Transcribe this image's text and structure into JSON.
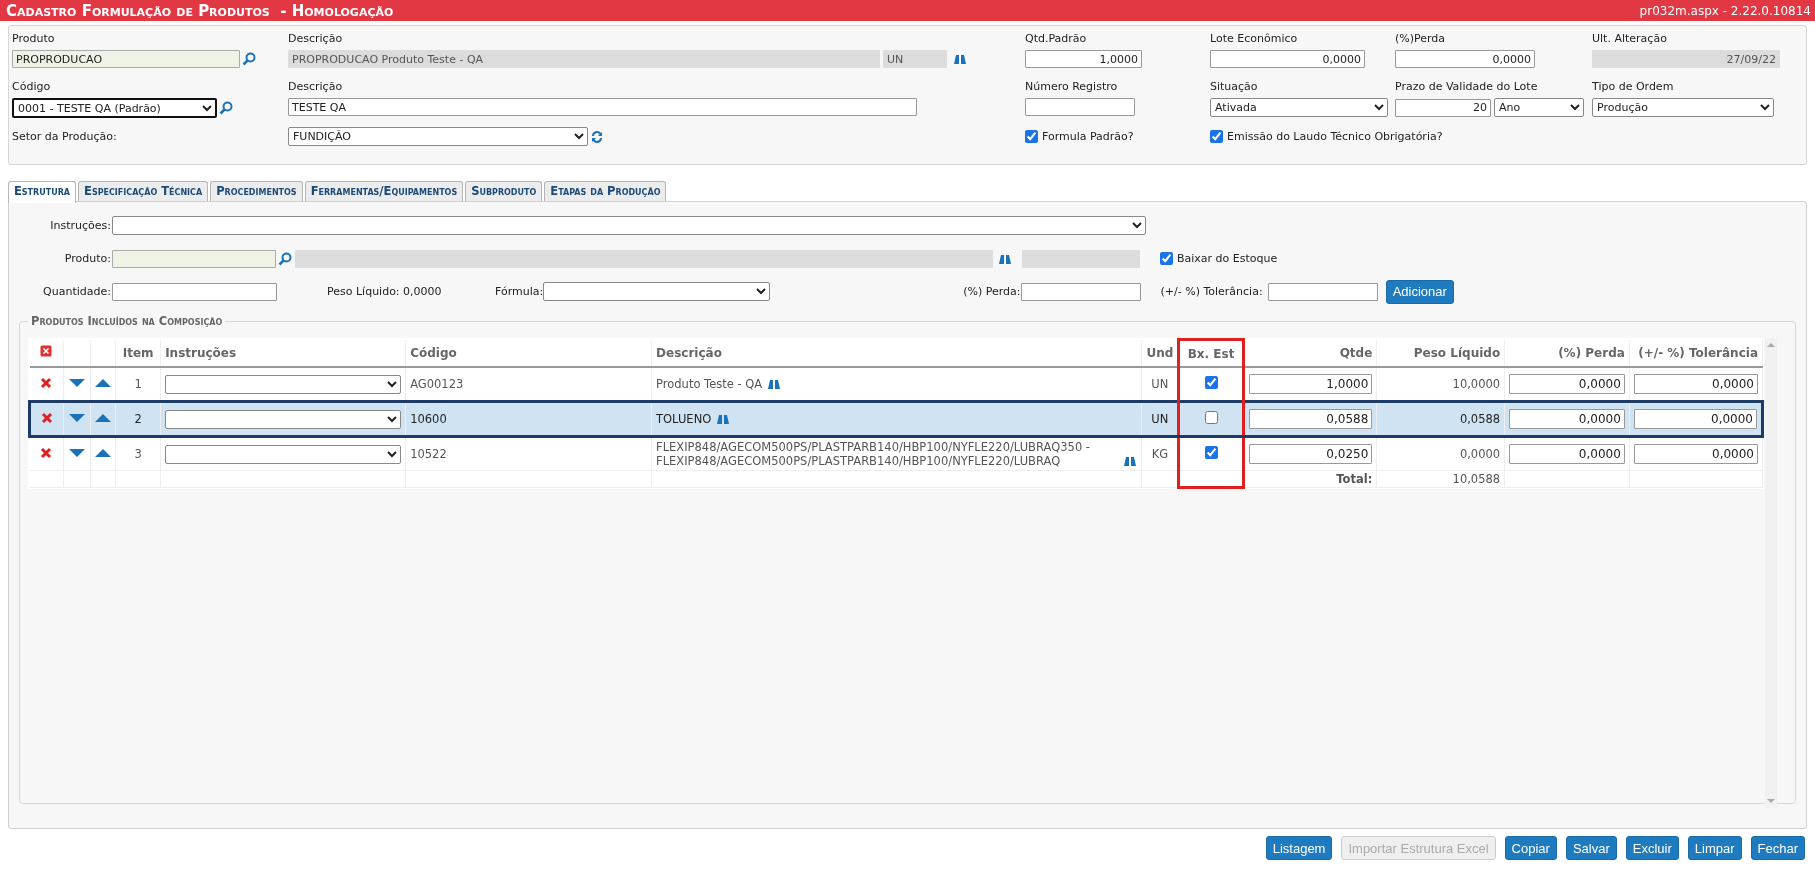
{
  "window": {
    "title": "Cadastro Formulação de Produtos  - Homologação",
    "version": "pr032m.aspx - 2.22.0.10814"
  },
  "header": {
    "produto": {
      "label": "Produto",
      "value": "PROPRODUCAO"
    },
    "descricao_produto": {
      "label": "Descrição",
      "value": "PROPRODUCAO Produto Teste - QA",
      "unit": "UN"
    },
    "qtd_padrao": {
      "label": "Qtd.Padrão",
      "value": "1,0000"
    },
    "lote_economico": {
      "label": "Lote Econômico",
      "value": "0,0000"
    },
    "perda": {
      "label": "(%)Perda",
      "value": "0,0000"
    },
    "ult_alteracao": {
      "label": "Ult. Alteração",
      "value": "27/09/22"
    },
    "codigo": {
      "label": "Código",
      "value": "0001 - TESTE QA (Padrão)"
    },
    "descricao_formula": {
      "label": "Descrição",
      "value": "TESTE QA"
    },
    "numero_registro": {
      "label": "Número Registro"
    },
    "situacao": {
      "label": "Situação",
      "value": "Ativada"
    },
    "prazo": {
      "label": "Prazo de Validade do Lote",
      "value": "20",
      "unit": "Ano"
    },
    "tipo_ordem": {
      "label": "Tipo de Ordem",
      "value": "Produção"
    },
    "setor": {
      "label": "Setor da Produção:",
      "value": "FUNDIÇÃO"
    },
    "checkboxes": [
      {
        "label": "Formula Padrão?",
        "checked": true
      },
      {
        "label": "Emissão do Laudo Técnico Obrigatória?",
        "checked": true
      }
    ]
  },
  "tabs": [
    {
      "label": "Estrutura",
      "selected": true
    },
    {
      "label": "Especificação Técnica",
      "selected": false
    },
    {
      "label": "Procedimentos",
      "selected": false
    },
    {
      "label": "Ferramentas/Equipamentos",
      "selected": false
    },
    {
      "label": "Subproduto",
      "selected": false
    },
    {
      "label": "Etapas da Produção",
      "selected": false
    }
  ],
  "form": {
    "instrucoes": "Instruções:",
    "produto": "Produto:",
    "baixar": {
      "label": "Baixar do Estoque",
      "checked": true
    },
    "quantidade": "Quantidade:",
    "peso_liquido": "Peso Líquido: 0,0000",
    "formula": "Fórmula:",
    "perda": "(%) Perda:",
    "tolerancia": "(+/- %) Tolerância:",
    "add_button": "Adicionar"
  },
  "composition": {
    "legend": "Produtos Incluídos na Composição",
    "columns": [
      "Item",
      "Instruções",
      "Código",
      "Descrição",
      "Und",
      "Bx. Est",
      "Qtde",
      "Peso Líquido",
      "(%) Perda",
      "(+/- %) Tolerância"
    ],
    "rows": [
      {
        "item": "1",
        "codigo": "AG00123",
        "descricao": "Produto Teste - QA",
        "und": "UN",
        "bx_est": true,
        "qtde": "1,0000",
        "peso": "10,0000",
        "perda": "0,0000",
        "tolerancia": "0,0000",
        "selected": false
      },
      {
        "item": "2",
        "codigo": "10600",
        "descricao": "TOLUENO",
        "und": "UN",
        "bx_est": false,
        "qtde": "0,0588",
        "peso": "0,0588",
        "perda": "0,0000",
        "tolerancia": "0,0000",
        "selected": true
      },
      {
        "item": "3",
        "codigo": "10522",
        "descricao": "FLEXIP848/AGECOM500PS/PLASTPARB140/HBP100/NYFLE220/LUBRAQ350 - FLEXIP848/AGECOM500PS/PLASTPARB140/HBP100/NYFLE220/LUBRAQ",
        "und": "KG",
        "bx_est": true,
        "qtde": "0,0250",
        "peso": "0,0000",
        "perda": "0,0000",
        "tolerancia": "0,0000",
        "selected": false
      }
    ],
    "total_label": "Total:",
    "total_value": "10,0588"
  },
  "buttons": [
    {
      "label": "Listagem",
      "disabled": false
    },
    {
      "label": "Importar Estrutura Excel",
      "disabled": true
    },
    {
      "label": "Copiar",
      "disabled": false
    },
    {
      "label": "Salvar",
      "disabled": false
    },
    {
      "label": "Excluir",
      "disabled": false
    },
    {
      "label": "Limpar",
      "disabled": false
    },
    {
      "label": "Fechar",
      "disabled": false
    }
  ]
}
